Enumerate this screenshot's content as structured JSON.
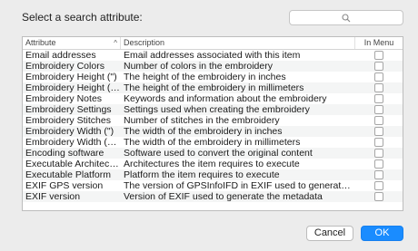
{
  "header": {
    "prompt": "Select a search attribute:"
  },
  "search": {
    "placeholder": "",
    "icon": "search-icon"
  },
  "table": {
    "columns": {
      "attribute": "Attribute",
      "description": "Description",
      "in_menu": "In Menu"
    },
    "sort_indicator": "^",
    "rows": [
      {
        "attribute": "Email addresses",
        "description": "Email addresses associated with this item",
        "in_menu": false
      },
      {
        "attribute": "Embroidery Colors",
        "description": "Number of colors in the embroidery",
        "in_menu": false
      },
      {
        "attribute": "Embroidery Height (\")",
        "description": "The height of the embroidery in inches",
        "in_menu": false
      },
      {
        "attribute": "Embroidery Height (mm)",
        "description": "The height of the embroidery in millimeters",
        "in_menu": false
      },
      {
        "attribute": "Embroidery Notes",
        "description": "Keywords and information about the embroidery",
        "in_menu": false
      },
      {
        "attribute": "Embroidery Settings",
        "description": "Settings used when creating the embroidery",
        "in_menu": false
      },
      {
        "attribute": "Embroidery Stitches",
        "description": "Number of stitches in the embroidery",
        "in_menu": false
      },
      {
        "attribute": "Embroidery Width (\")",
        "description": "The width of the embroidery in inches",
        "in_menu": false
      },
      {
        "attribute": "Embroidery Width (mm)",
        "description": "The width of the embroidery in millimeters",
        "in_menu": false
      },
      {
        "attribute": "Encoding software",
        "description": "Software used to convert the original content",
        "in_menu": false
      },
      {
        "attribute": "Executable Architectur...",
        "description": "Architectures the item requires to execute",
        "in_menu": false
      },
      {
        "attribute": "Executable Platform",
        "description": "Platform the item requires to execute",
        "in_menu": false
      },
      {
        "attribute": "EXIF GPS version",
        "description": "The version of GPSInfoIFD in EXIF used to generate the me...",
        "in_menu": false
      },
      {
        "attribute": "EXIF version",
        "description": "Version of EXIF used to generate the metadata",
        "in_menu": false
      }
    ]
  },
  "buttons": {
    "cancel": "Cancel",
    "ok": "OK"
  },
  "colors": {
    "accent": "#1a8cff",
    "background": "#ececec"
  }
}
